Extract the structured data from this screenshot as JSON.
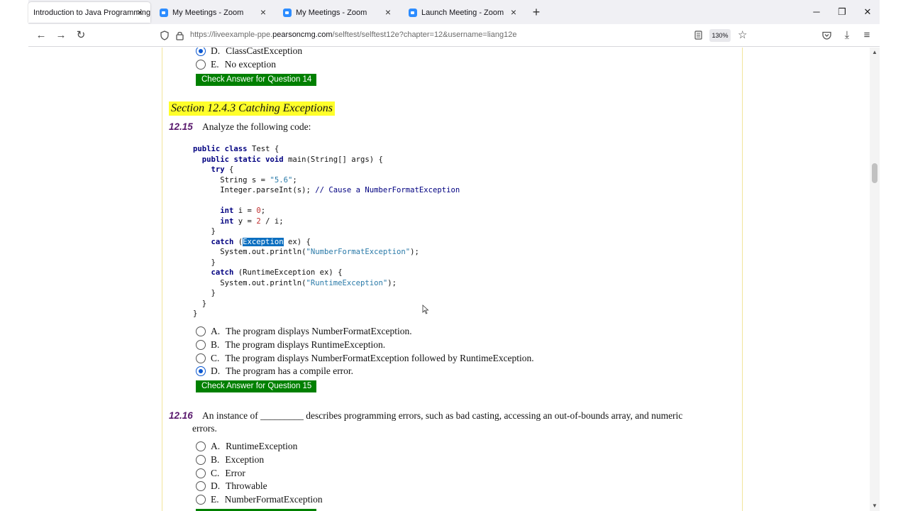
{
  "browser": {
    "tabs": [
      {
        "label": "Introduction to Java Programming",
        "active": true
      },
      {
        "label": "My Meetings - Zoom",
        "active": false
      },
      {
        "label": "My Meetings - Zoom",
        "active": false
      },
      {
        "label": "Launch Meeting - Zoom",
        "active": false
      }
    ],
    "url_prefix": "https://liveexample-ppe.",
    "url_domain": "pearsoncmg.com",
    "url_path": "/selftest/selftest12e?chapter=12&username=liang12e",
    "zoom": "130%"
  },
  "page": {
    "q14": {
      "choices": [
        {
          "letter": "D.",
          "text": "ClassCastException",
          "checked": true
        },
        {
          "letter": "E.",
          "text": "No exception",
          "checked": false
        }
      ],
      "check_label": "Check Answer for Question 14"
    },
    "section_title": "Section 12.4.3 Catching Exceptions",
    "q15": {
      "number": "12.15",
      "prompt": "Analyze the following code:",
      "choices": [
        {
          "letter": "A.",
          "text": "The program displays NumberFormatException.",
          "checked": false
        },
        {
          "letter": "B.",
          "text": "The program displays RuntimeException.",
          "checked": false
        },
        {
          "letter": "C.",
          "text": "The program displays NumberFormatException followed by RuntimeException.",
          "checked": false
        },
        {
          "letter": "D.",
          "text": "The program has a compile error.",
          "checked": true
        }
      ],
      "check_label": "Check Answer for Question 15"
    },
    "q16": {
      "number": "12.16",
      "prompt_line1": "An instance of _________ describes programming errors, such as bad casting, accessing an out-of-bounds array, and numeric",
      "prompt_line2": "errors.",
      "choices": [
        {
          "letter": "A.",
          "text": "RuntimeException",
          "checked": false
        },
        {
          "letter": "B.",
          "text": "Exception",
          "checked": false
        },
        {
          "letter": "C.",
          "text": "Error",
          "checked": false
        },
        {
          "letter": "D.",
          "text": "Throwable",
          "checked": false
        },
        {
          "letter": "E.",
          "text": "NumberFormatException",
          "checked": false
        }
      ]
    }
  },
  "colors": {
    "check_button": "#008000",
    "section_highlight": "#ffff2a",
    "question_number": "#5a1a6e",
    "selection": "#0b6fc0"
  }
}
